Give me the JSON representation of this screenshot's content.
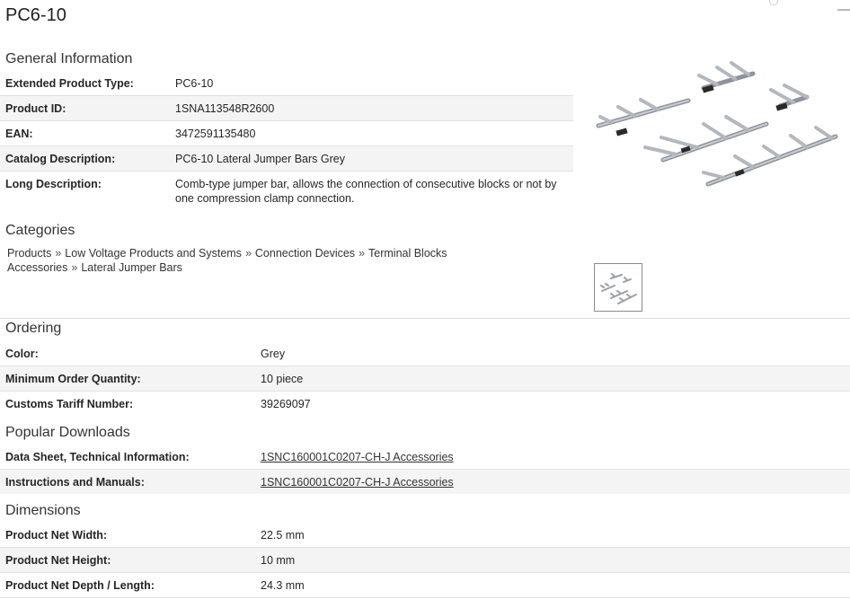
{
  "page": {
    "title": "PC6-10"
  },
  "general": {
    "heading": "General Information",
    "rows": [
      {
        "key": "Extended Product Type:",
        "value": "PC6-10"
      },
      {
        "key": "Product ID:",
        "value": "1SNA113548R2600"
      },
      {
        "key": "EAN:",
        "value": "3472591135480"
      },
      {
        "key": "Catalog Description:",
        "value": "PC6-10 Lateral Jumper Bars Grey"
      },
      {
        "key": "Long Description:",
        "value": "Comb-type jumper bar, allows the connection of consecutive blocks or not by one compression clamp connection."
      }
    ]
  },
  "categories": {
    "heading": "Categories",
    "crumbs": [
      "Products",
      "Low Voltage Products and Systems",
      "Connection Devices",
      "Terminal Blocks Accessories",
      "Lateral Jumper Bars"
    ],
    "separator": "»"
  },
  "ordering": {
    "heading": "Ordering",
    "rows": [
      {
        "key": "Color:",
        "value": "Grey"
      },
      {
        "key": "Minimum Order Quantity:",
        "value": "10 piece"
      },
      {
        "key": "Customs Tariff Number:",
        "value": "39269097"
      }
    ]
  },
  "downloads": {
    "heading": "Popular Downloads",
    "rows": [
      {
        "key": "Data Sheet, Technical Information:",
        "value": "1SNC160001C0207-CH-J Accessories"
      },
      {
        "key": "Instructions and Manuals:",
        "value": "1SNC160001C0207-CH-J Accessories"
      }
    ]
  },
  "dimensions": {
    "heading": "Dimensions",
    "rows": [
      {
        "key": "Product Net Width:",
        "value": "22.5 mm"
      },
      {
        "key": "Product Net Height:",
        "value": "10 mm"
      },
      {
        "key": "Product Net Depth / Length:",
        "value": "24.3 mm"
      }
    ]
  },
  "colors": {
    "row_alt": "#f4f4f4",
    "divider": "#d8d8d8",
    "bar": "#9aa0a8"
  }
}
